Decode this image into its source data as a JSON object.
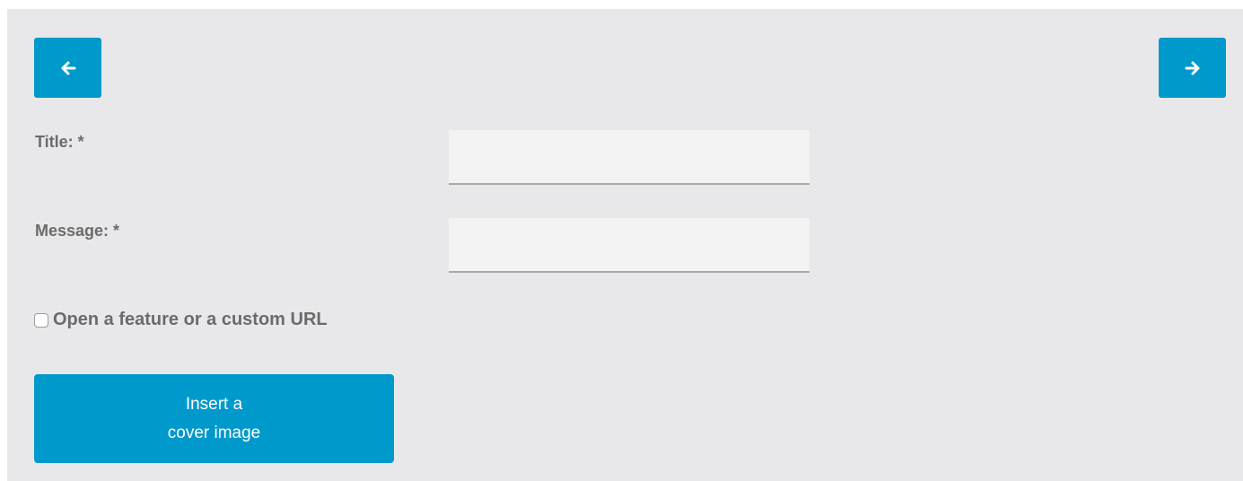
{
  "nav": {
    "prev_icon": "arrow-left-icon",
    "next_icon": "arrow-right-icon"
  },
  "form": {
    "title_label": "Title: *",
    "title_value": "",
    "message_label": "Message: *",
    "message_value": "",
    "custom_url_checkbox_label": "Open a feature or a custom URL",
    "custom_url_checked": false,
    "cover_button_line1": "Insert a",
    "cover_button_line2": "cover image"
  },
  "colors": {
    "accent": "#0099cc",
    "panel_background": "#e8e8ea",
    "label_text": "#6b6b6b",
    "field_background": "#f3f3f3",
    "field_underline": "#a9a9a9"
  }
}
